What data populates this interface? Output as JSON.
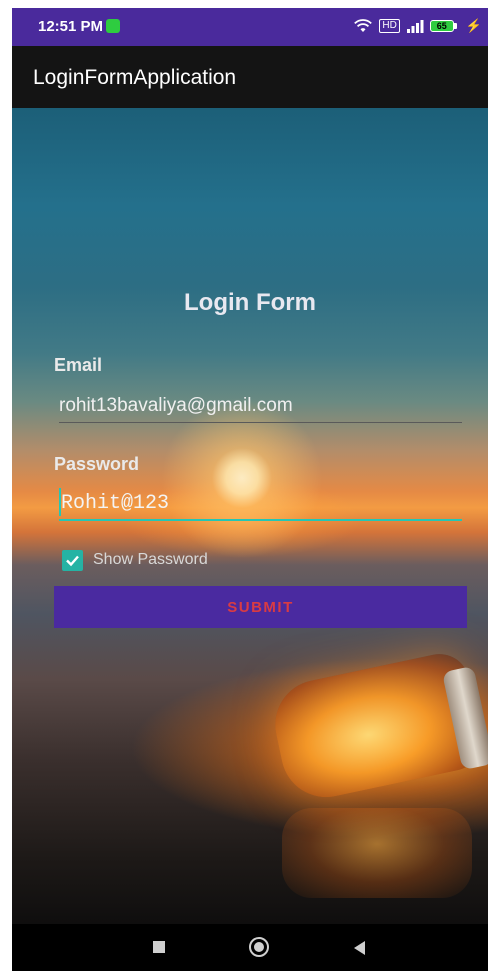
{
  "status_bar": {
    "time": "12:51 PM",
    "volte": "HD",
    "battery": "65",
    "icons": [
      "notification-icon",
      "wifi-icon",
      "volte-icon",
      "signal-icon",
      "battery-icon",
      "charging-icon"
    ]
  },
  "app_bar": {
    "title": "LoginFormApplication"
  },
  "form": {
    "title": "Login Form",
    "email_label": "Email",
    "email_value": "rohit13bavaliya@gmail.com",
    "password_label": "Password",
    "password_value": "Rohit@123",
    "show_password_label": "Show Password",
    "show_password_checked": true,
    "submit_label": "SUBMIT"
  },
  "nav_bar": {
    "icons": [
      "recents-icon",
      "home-icon",
      "back-icon"
    ]
  },
  "colors": {
    "status_bar": "#4a2a9c",
    "app_bar": "#141414",
    "accent": "#25c6b4",
    "button_bg": "#4a2aa0",
    "button_text": "#d93b43"
  }
}
